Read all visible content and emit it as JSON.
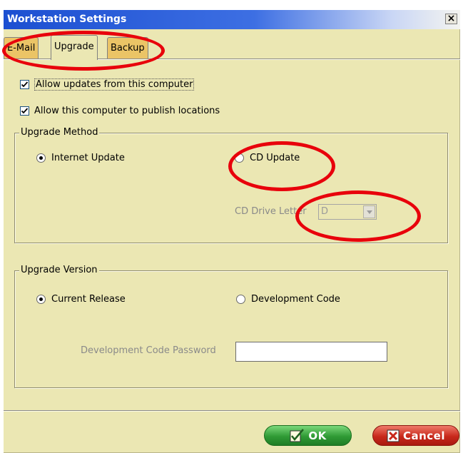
{
  "window": {
    "title": "Workstation Settings",
    "close_label": "×"
  },
  "tabs": [
    {
      "label": "E-Mail",
      "active": false
    },
    {
      "label": "Upgrade",
      "active": true
    },
    {
      "label": "Backup",
      "active": false
    }
  ],
  "checkboxes": [
    {
      "label": "Allow updates from this computer",
      "checked": true
    },
    {
      "label": "Allow this computer to publish locations",
      "checked": true
    }
  ],
  "upgrade_method": {
    "legend": "Upgrade Method",
    "options": [
      {
        "label": "Internet Update",
        "checked": true
      },
      {
        "label": "CD Update",
        "checked": false
      }
    ],
    "cd_drive": {
      "label": "CD Drive Letter",
      "value": "D",
      "enabled": false
    }
  },
  "upgrade_version": {
    "legend": "Upgrade Version",
    "options": [
      {
        "label": "Current Release",
        "checked": true
      },
      {
        "label": "Development Code",
        "checked": false
      }
    ],
    "password": {
      "label": "Development Code Password",
      "value": ""
    }
  },
  "buttons": {
    "ok": "OK",
    "cancel": "Cancel"
  },
  "colors": {
    "dialog_bg": "#ebe7b3",
    "title_bar": "#1c4fd1",
    "inactive_tab": "#ebc466",
    "ok_green": "#2f9a35",
    "cancel_red": "#c8281b",
    "annotation_red": "#e8000b"
  },
  "icons": {
    "ok": "checkmark-page-icon",
    "cancel": "x-box-icon",
    "close": "close-icon"
  }
}
